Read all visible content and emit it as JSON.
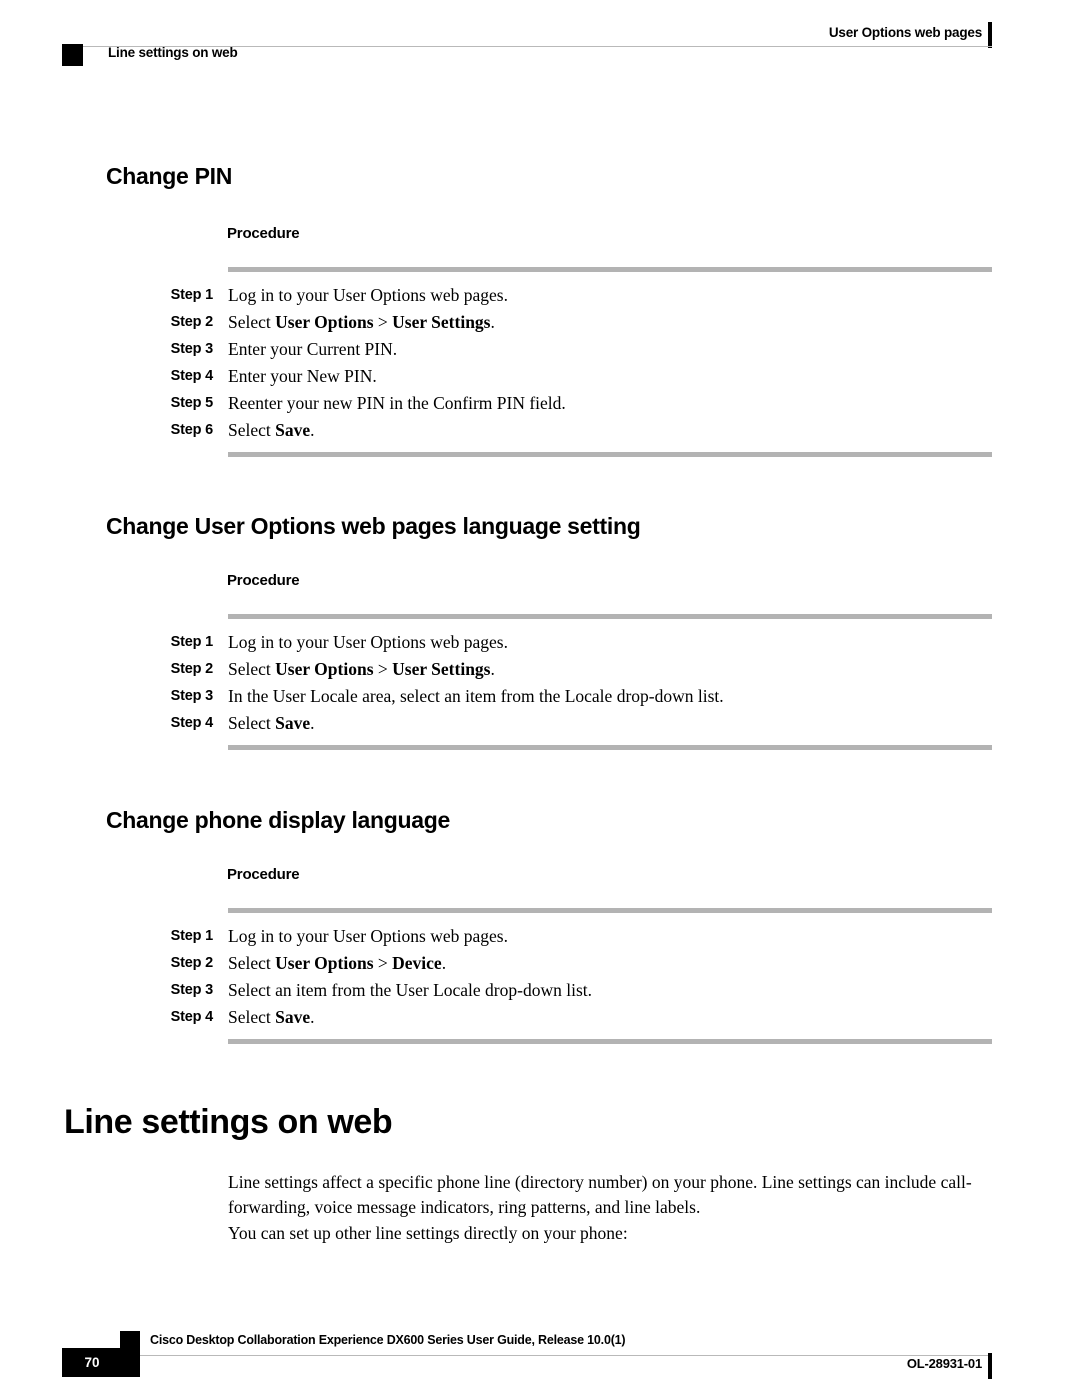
{
  "header": {
    "running_head_right": "User Options web pages",
    "running_head_left": "Line settings on web"
  },
  "sections": [
    {
      "heading": "Change PIN",
      "procedure_label": "Procedure",
      "steps": [
        {
          "num": "Step 1",
          "text": "Log in to your User Options web pages."
        },
        {
          "num": "Step 2",
          "text_parts": [
            {
              "t": "Select ",
              "b": false
            },
            {
              "t": "User Options",
              "b": true
            },
            {
              "t": " > ",
              "b": false
            },
            {
              "t": "User Settings",
              "b": true
            },
            {
              "t": ".",
              "b": false
            }
          ]
        },
        {
          "num": "Step 3",
          "text": "Enter your Current PIN."
        },
        {
          "num": "Step 4",
          "text": "Enter your New PIN."
        },
        {
          "num": "Step 5",
          "text": "Reenter your new PIN in the Confirm PIN field."
        },
        {
          "num": "Step 6",
          "text_parts": [
            {
              "t": "Select ",
              "b": false
            },
            {
              "t": "Save",
              "b": true
            },
            {
              "t": ".",
              "b": false
            }
          ]
        }
      ]
    },
    {
      "heading": "Change User Options web pages language setting",
      "procedure_label": "Procedure",
      "steps": [
        {
          "num": "Step 1",
          "text": "Log in to your User Options web pages."
        },
        {
          "num": "Step 2",
          "text_parts": [
            {
              "t": "Select ",
              "b": false
            },
            {
              "t": "User Options",
              "b": true
            },
            {
              "t": " > ",
              "b": false
            },
            {
              "t": "User Settings",
              "b": true
            },
            {
              "t": ".",
              "b": false
            }
          ]
        },
        {
          "num": "Step 3",
          "text": "In the User Locale area, select an item from the Locale drop-down list."
        },
        {
          "num": "Step 4",
          "text_parts": [
            {
              "t": "Select ",
              "b": false
            },
            {
              "t": "Save",
              "b": true
            },
            {
              "t": ".",
              "b": false
            }
          ]
        }
      ]
    },
    {
      "heading": "Change phone display language",
      "procedure_label": "Procedure",
      "steps": [
        {
          "num": "Step 1",
          "text": "Log in to your User Options web pages."
        },
        {
          "num": "Step 2",
          "text_parts": [
            {
              "t": "Select ",
              "b": false
            },
            {
              "t": "User Options",
              "b": true
            },
            {
              "t": " > ",
              "b": false
            },
            {
              "t": "Device",
              "b": true
            },
            {
              "t": ".",
              "b": false
            }
          ]
        },
        {
          "num": "Step 3",
          "text": "Select an item from the User Locale drop-down list."
        },
        {
          "num": "Step 4",
          "text_parts": [
            {
              "t": "Select ",
              "b": false
            },
            {
              "t": "Save",
              "b": true
            },
            {
              "t": ".",
              "b": false
            }
          ]
        }
      ]
    }
  ],
  "chapter": {
    "title": "Line settings on web",
    "paragraphs": [
      "Line settings affect a specific phone line (directory number) on your phone. Line settings can include call-forwarding, voice message indicators, ring patterns, and line labels.",
      "You can set up other line settings directly on your phone:"
    ]
  },
  "footer": {
    "guide_title": "Cisco Desktop Collaboration Experience DX600 Series User Guide, Release 10.0(1)",
    "page_number": "70",
    "doc_id": "OL-28931-01"
  },
  "colors": {
    "rule_gray": "#b3b3b3",
    "hairline_gray": "#b9b9b9",
    "ink": "#000000",
    "paper": "#ffffff"
  }
}
